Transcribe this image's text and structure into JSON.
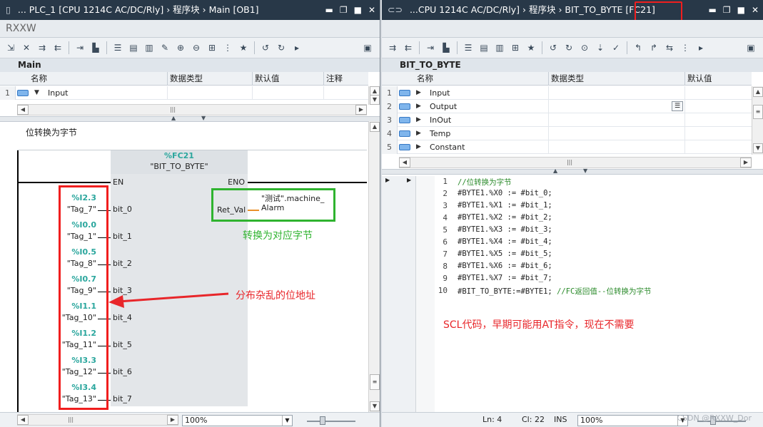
{
  "left": {
    "title_icon": "pin-icon",
    "title_prefix": "...",
    "title": "PLC_1 [CPU 1214C AC/DC/Rly] › 程序块 › Main [OB1]",
    "tab_label": "RXXW",
    "block_name": "Main",
    "iface_headers": [
      "名称",
      "数据类型",
      "默认值",
      "注释"
    ],
    "iface_row": {
      "num": "1",
      "name": "Input"
    },
    "network_title": "位转换为字节",
    "fb": {
      "instance": "%FC21",
      "block_name": "\"BIT_TO_BYTE\"",
      "en": "EN",
      "eno": "ENO",
      "ret_pin": "Ret_Val",
      "ret_tag_line1": "\"测试\".machine_",
      "ret_tag_line2": "Alarm",
      "inputs": [
        {
          "addr": "%I2.3",
          "tag": "\"Tag_7\"",
          "pin": "bit_0"
        },
        {
          "addr": "%I0.0",
          "tag": "\"Tag_1\"",
          "pin": "bit_1"
        },
        {
          "addr": "%I0.5",
          "tag": "\"Tag_8\"",
          "pin": "bit_2"
        },
        {
          "addr": "%I0.7",
          "tag": "\"Tag_9\"",
          "pin": "bit_3"
        },
        {
          "addr": "%I1.1",
          "tag": "\"Tag_10\"",
          "pin": "bit_4"
        },
        {
          "addr": "%I1.2",
          "tag": "\"Tag_11\"",
          "pin": "bit_5"
        },
        {
          "addr": "%I3.3",
          "tag": "\"Tag_12\"",
          "pin": "bit_6"
        },
        {
          "addr": "%I3.4",
          "tag": "\"Tag_13\"",
          "pin": "bit_7"
        }
      ]
    },
    "annotation_green": "转换为对应字节",
    "annotation_red": "分布杂乱的位地址",
    "zoom": "100%"
  },
  "right": {
    "title_prefix": "...",
    "title_main": "CPU 1214C AC/DC/Rly] › 程序块 › BIT_TO_BYTE ",
    "title_highlight": "[FC21]",
    "block_name": "BIT_TO_BYTE",
    "iface_headers": [
      "名称",
      "数据类型",
      "默认值"
    ],
    "iface_rows": [
      {
        "num": "1",
        "name": "Input"
      },
      {
        "num": "2",
        "name": "Output"
      },
      {
        "num": "3",
        "name": "InOut"
      },
      {
        "num": "4",
        "name": "Temp"
      },
      {
        "num": "5",
        "name": "Constant"
      }
    ],
    "code_lines": [
      {
        "n": "1",
        "code": "",
        "comment": "//位转换为字节"
      },
      {
        "n": "2",
        "code": "#BYTE1.%X0 := #bit_0;",
        "comment": ""
      },
      {
        "n": "3",
        "code": "#BYTE1.%X1 := #bit_1;",
        "comment": ""
      },
      {
        "n": "4",
        "code": "#BYTE1.%X2 := #bit_2;",
        "comment": ""
      },
      {
        "n": "5",
        "code": "#BYTE1.%X3 := #bit_3;",
        "comment": ""
      },
      {
        "n": "6",
        "code": "#BYTE1.%X4 := #bit_4;",
        "comment": ""
      },
      {
        "n": "7",
        "code": "#BYTE1.%X5 := #bit_5;",
        "comment": ""
      },
      {
        "n": "8",
        "code": "#BYTE1.%X6 := #bit_6;",
        "comment": ""
      },
      {
        "n": "9",
        "code": "#BYTE1.%X7 := #bit_7;",
        "comment": ""
      },
      {
        "n": "10",
        "code": "#BIT_TO_BYTE:=#BYTE1; ",
        "comment": "//FC返回值--位转换为字节"
      }
    ],
    "annotation_red": "SCL代码，早期可能用AT指令，现在不需要",
    "status": {
      "ln": "Ln: 4",
      "cl": "Cl: 22",
      "ins": "INS",
      "zoom": "100%"
    },
    "watermark": "CSDN @RXXW_Dor"
  },
  "colors": {
    "annotation_red": "#e8262a",
    "annotation_green": "#2fb32f",
    "address_teal": "#2aa69d",
    "titlebar": "#283848"
  }
}
